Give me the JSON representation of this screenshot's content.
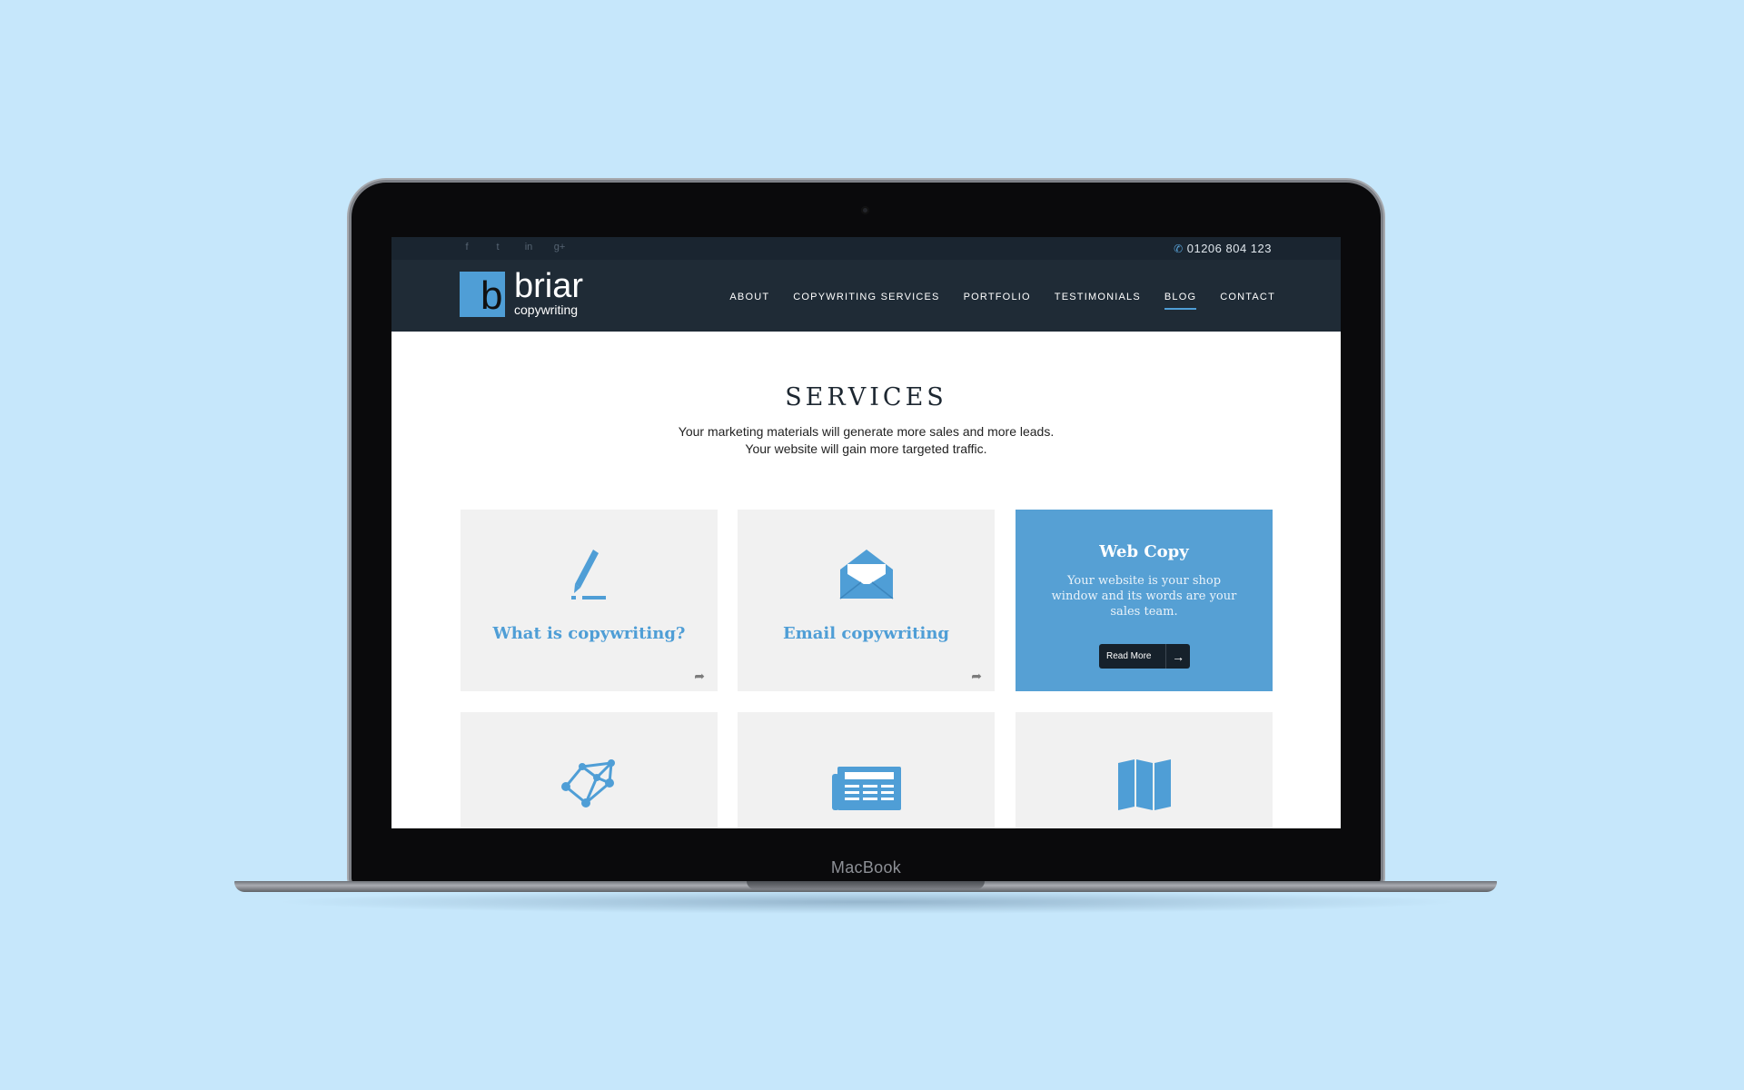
{
  "topbar": {
    "socials": [
      "f",
      "t",
      "in",
      "g+"
    ],
    "phone": "01206 804 123"
  },
  "logo": {
    "letter": "b",
    "name": "briar",
    "sub": "copywriting"
  },
  "nav": [
    {
      "label": "About"
    },
    {
      "label": "Copywriting Services"
    },
    {
      "label": "Portfolio"
    },
    {
      "label": "Testimonials"
    },
    {
      "label": "Blog"
    },
    {
      "label": "Contact"
    }
  ],
  "services": {
    "heading": "SERVICES",
    "intro": "Your marketing materials will generate more sales and more leads. Your website will gain more targeted traffic."
  },
  "cards": [
    {
      "title": "What is copywriting?",
      "icon": "pen-icon"
    },
    {
      "title": "Email copywriting",
      "icon": "envelope-icon"
    },
    {
      "title": "Web Copy",
      "icon": "none",
      "text": "Your website is your shop window and its words are your sales team.",
      "button": "Read More"
    },
    {
      "title": "",
      "icon": "network-icon"
    },
    {
      "title": "",
      "icon": "newspaper-icon"
    },
    {
      "title": "",
      "icon": "map-icon"
    }
  ],
  "device": {
    "label": "MacBook"
  },
  "colors": {
    "accent": "#4f9ed6",
    "nav_bg": "#1f2b36",
    "topbar_bg": "#1a2530",
    "page_bg": "#c6e7fb"
  }
}
